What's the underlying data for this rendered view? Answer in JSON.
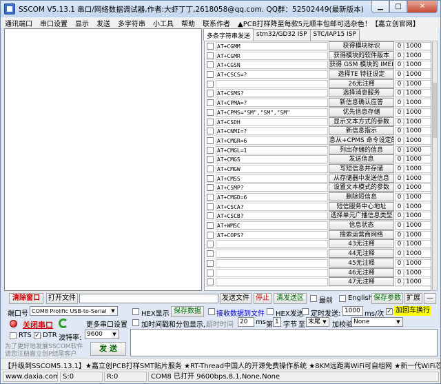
{
  "window": {
    "title": "SSCOM V5.13.1 串口/网络数据调试器,作者:大虾丁丁,2618058@qq.com. QQ群：52502449(最新版本)"
  },
  "menu": [
    "通讯端口",
    "串口设置",
    "显示",
    "发送",
    "多字符串",
    "小工具",
    "帮助",
    "联系作者",
    "▲PCB打样降至每款5元顺丰包邮可选杂色！【嘉立创官网】"
  ],
  "tabs": [
    "多条字符串发送",
    "stm32/GD32 ISP",
    "STC/IAP15 ISP"
  ],
  "rows": [
    {
      "cmd": "AT+CGMM",
      "btn": "获得模块标识",
      "n": "0",
      "d": "1000"
    },
    {
      "cmd": "AT+CGMR",
      "btn": "获得模块的软件版本",
      "n": "0",
      "d": "1000"
    },
    {
      "cmd": "AT+CGSN",
      "btn": "获得 GSM  模块的 IMEI",
      "n": "0",
      "d": "1000"
    },
    {
      "cmd": "AT+CSCS=?",
      "btn": "选择TE  特征设定",
      "n": "0",
      "d": "1000"
    },
    {
      "cmd": "",
      "btn": "26无注释",
      "n": "0",
      "d": "1000"
    },
    {
      "cmd": "AT+CSMS?",
      "btn": "选择消息服务",
      "n": "0",
      "d": "1000"
    },
    {
      "cmd": "AT+CPMA=?",
      "btn": "新信息确认应答",
      "n": "0",
      "d": "1000"
    },
    {
      "cmd": "AT+CPMS=\"SM\",\"SM\",\"SM\"",
      "btn": "优先信息存储",
      "n": "0",
      "d": "1000"
    },
    {
      "cmd": "AT+CSDH",
      "btn": "显示文本方式的参数",
      "n": "0",
      "d": "1000"
    },
    {
      "cmd": "AT+CNMI=?",
      "btn": "新信息指示",
      "n": "0",
      "d": "1000"
    },
    {
      "cmd": "AT+CMGR=6",
      "btn": "息从+CPMS 命令设定的存",
      "n": "0",
      "d": "1000"
    },
    {
      "cmd": "AT+CMGL=1",
      "btn": "列出存储的信息",
      "n": "0",
      "d": "1000"
    },
    {
      "cmd": "AT+CMGS",
      "btn": "发送信息",
      "n": "0",
      "d": "1000"
    },
    {
      "cmd": "AT+CMGW",
      "btn": "写短信息并存储",
      "n": "0",
      "d": "1000"
    },
    {
      "cmd": "AT+CMSS",
      "btn": "从存储器中发送信息",
      "n": "0",
      "d": "1000"
    },
    {
      "cmd": "AT+CSMP?",
      "btn": "设置文本模式的参数",
      "n": "0",
      "d": "1000"
    },
    {
      "cmd": "AT+CMGD=6",
      "btn": "删除短信息",
      "n": "0",
      "d": "1000"
    },
    {
      "cmd": "AT+CSCA?",
      "btn": "短信服务中心地址",
      "n": "0",
      "d": "1000"
    },
    {
      "cmd": "AT+CSCB?",
      "btn": "选择单元广播信息类型",
      "n": "0",
      "d": "1000"
    },
    {
      "cmd": "AT+WMSC",
      "btn": "信息状态",
      "n": "0",
      "d": "1000"
    },
    {
      "cmd": "AT+COPS?",
      "btn": "搜索运营商网络",
      "n": "0",
      "d": "1000"
    },
    {
      "cmd": "",
      "btn": "43无注释",
      "n": "0",
      "d": "1000"
    },
    {
      "cmd": "",
      "btn": "44无注释",
      "n": "0",
      "d": "1000"
    },
    {
      "cmd": "",
      "btn": "45无注释",
      "n": "0",
      "d": "1000"
    },
    {
      "cmd": "",
      "btn": "46无注释",
      "n": "0",
      "d": "1000"
    },
    {
      "cmd": "",
      "btn": "47无注释",
      "n": "0",
      "d": "1000"
    }
  ],
  "bar1": {
    "clear": "清除窗口",
    "open_file": "打开文件",
    "send_file": "发送文件",
    "stop": "停止",
    "clear_send": "清发送区",
    "front": "最前",
    "english": "English",
    "save_params": "保存参数",
    "expand": "扩展",
    "dash": "—"
  },
  "port": {
    "label": "端口号",
    "value": "COM8 Prolific USB-to-Serial",
    "hex_show": "HEX显示",
    "save_data": "保存数据",
    "recv_to_file": "接收数据到文件",
    "hex_send": "HEX发送",
    "timed_send": "定时发送:",
    "interval": "1000",
    "ms_per": "ms/次",
    "append_crlf": "加回车换行"
  },
  "conn": {
    "close_port": "关闭串口",
    "more_ports": "更多串口设置",
    "timestamp": "加时间戳和分包显示,",
    "timeout_label": "超时时间",
    "timeout": "20",
    "ms": "ms",
    "page_label": "第",
    "byte_no": "1",
    "byte": "字节",
    "to": "至",
    "end": "末尾",
    "checksum": "加校验",
    "check_value": "None"
  },
  "rtsdtr": {
    "rts": "RTS",
    "dtr": "DTR",
    "baud_label": "波特率:",
    "baud": "9600"
  },
  "promo": {
    "line1": "为了更好地发展SSCOM软件",
    "line2": "请您注册嘉立创P结尾客户",
    "send": "发  送"
  },
  "ticker": "【升级到SSCOM5.13.1】★嘉立创PCB打样SMT贴片服务  ★RT-Thread中国人的开源免费操作系统  ★8KM远距离WiFi可自组网  ★新一代WiFi芯片兼容8266",
  "status": {
    "url": "www.daxia.com",
    "s": "S:0",
    "r": "R:0",
    "com": "COM8 已打开  9600bps,8,1,None,None"
  }
}
